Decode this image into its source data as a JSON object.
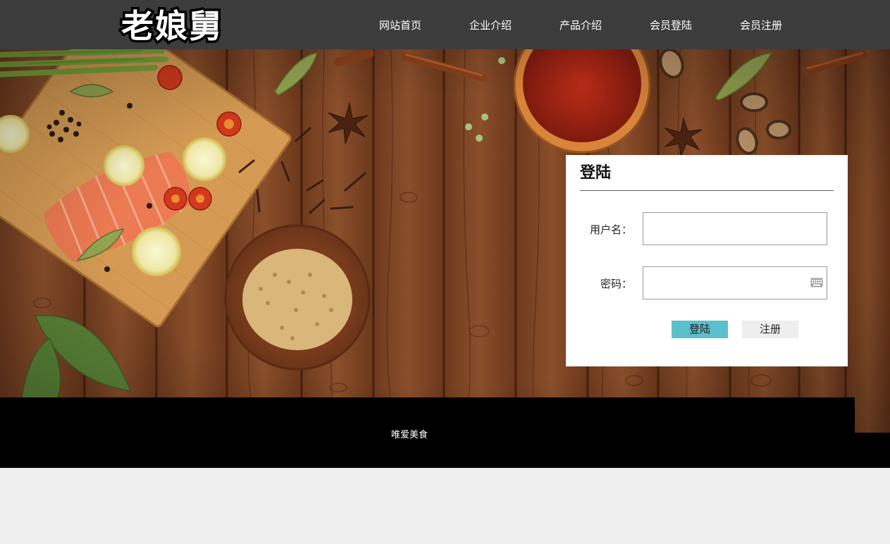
{
  "header": {
    "logo_text": "老娘舅",
    "nav": [
      {
        "label": "网站首页"
      },
      {
        "label": "企业介绍"
      },
      {
        "label": "产品介绍"
      },
      {
        "label": "会员登陆"
      },
      {
        "label": "会员注册"
      }
    ]
  },
  "login": {
    "title": "登陆",
    "username_label": "用户名：",
    "username_value": "",
    "password_label": "密码：",
    "password_value": "",
    "password_icon": "keyboard-icon",
    "submit_label": "登陆",
    "register_label": "注册"
  },
  "footer": {
    "text": "唯爱美食"
  },
  "colors": {
    "header_bg": "#3c3c3c",
    "login_button": "#5bbfcc",
    "register_button": "#eeeeee",
    "footer_bg": "#000000",
    "page_bg": "#efefef",
    "wood": "#7a4424"
  }
}
